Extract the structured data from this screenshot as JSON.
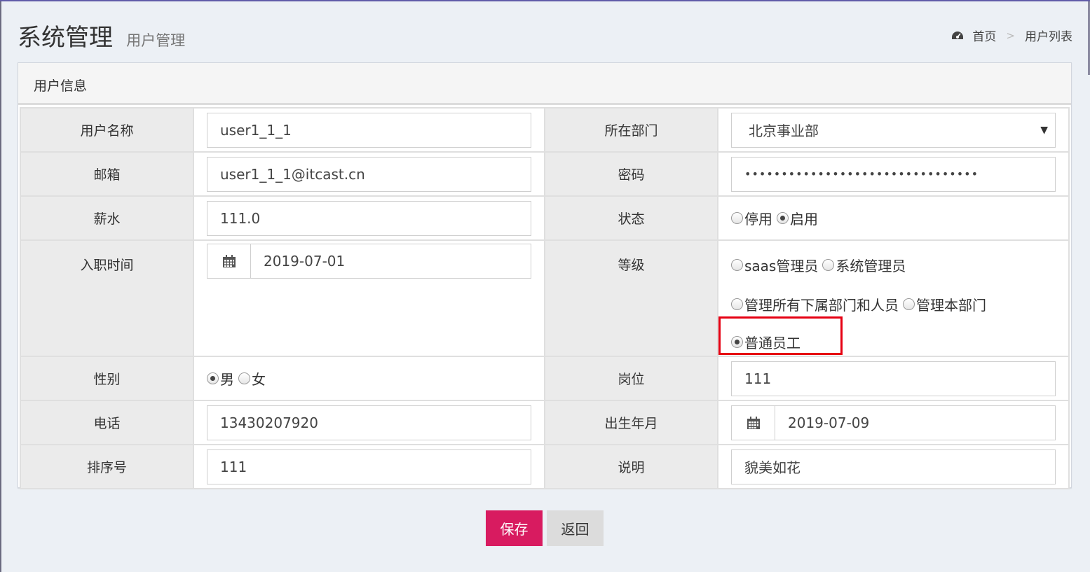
{
  "header": {
    "title": "系统管理",
    "subtitle": "用户管理",
    "breadcrumb": {
      "home": "首页",
      "sep": ">",
      "current": "用户列表"
    }
  },
  "box": {
    "title": "用户信息"
  },
  "form": {
    "username_label": "用户名称",
    "username_value": "user1_1_1",
    "dept_label": "所在部门",
    "dept_value": "北京事业部",
    "email_label": "邮箱",
    "email_value": "user1_1_1@itcast.cn",
    "password_label": "密码",
    "password_value": "••••••••••••••••••••••••••••••••",
    "salary_label": "薪水",
    "salary_value": "111.0",
    "status_label": "状态",
    "status_options": [
      "停用",
      "启用"
    ],
    "status_selected": "启用",
    "hire_label": "入职时间",
    "hire_value": "2019-07-01",
    "grade_label": "等级",
    "grade_options": [
      "saas管理员",
      "系统管理员",
      "管理所有下属部门和人员",
      "管理本部门",
      "普通员工"
    ],
    "grade_selected": "普通员工",
    "gender_label": "性别",
    "gender_options": [
      "男",
      "女"
    ],
    "gender_selected": "男",
    "post_label": "岗位",
    "post_value": "111",
    "phone_label": "电话",
    "phone_value": "13430207920",
    "birth_label": "出生年月",
    "birth_value": "2019-07-09",
    "order_label": "排序号",
    "order_value": "111",
    "remark_label": "说明",
    "remark_value": "貌美如花"
  },
  "buttons": {
    "save": "保存",
    "back": "返回"
  },
  "colors": {
    "save_bg": "#d81b60",
    "highlight": "#e60012",
    "topbar": "#605ca8"
  }
}
